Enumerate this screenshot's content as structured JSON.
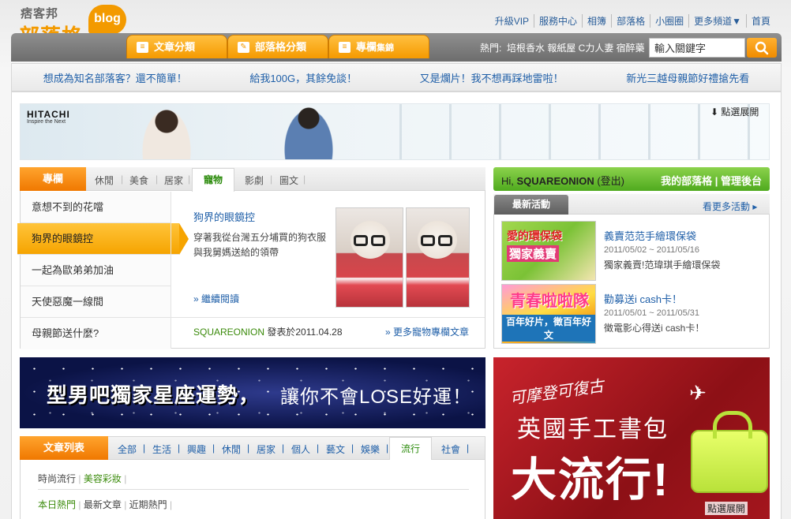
{
  "header": {
    "logo_small": "痞客邦",
    "logo_big": "部落格",
    "logo_badge": "blog",
    "top_links": [
      "升級VIP",
      "服務中心",
      "相簿",
      "部落格",
      "小圈圈",
      "更多頻道▼",
      "首頁"
    ],
    "nav_tabs": [
      "文章分類",
      "部落格分類",
      "專欄"
    ],
    "nav_tab_suffix": "集錦",
    "hot_label": "熱門:",
    "hot_words": "培根香水 報紙屋 C力人妻 宿醉藥",
    "search": {
      "placeholder": "輸入關鍵字",
      "value": "輸入關鍵字"
    }
  },
  "promo_links": [
    "想成為知名部落客？還不簡單！",
    "給我100G，其餘免談！",
    "又是爛片！我不想再踩地雷啦！",
    "新光三越母親節好禮搶先看"
  ],
  "banner": {
    "brand": "HITACHI",
    "brand_sub": "Inspire the Next",
    "expand_label": "點選展開"
  },
  "column": {
    "head_label": "專欄",
    "tabs": [
      "休閒",
      "美食",
      "居家",
      "寵物",
      "影劇",
      "圖文"
    ],
    "active_tab": "寵物",
    "list": [
      "意想不到的花噹",
      "狗界的眼鏡控",
      "一起為歐弟弟加油",
      "天使惡魔一線間",
      "母親節送什麼?"
    ],
    "active_item": "狗界的眼鏡控",
    "article_title": "狗界的眼鏡控",
    "article_body": "穿著我從台灣五分埔買的狗衣服與我舅媽送給的領帶",
    "read_more": "» 繼續閱讀",
    "author": "SQUAREONION",
    "posted": " 發表於2011.04.28",
    "more_link": "» 更多寵物專欄文章"
  },
  "user": {
    "greeting": "Hi, ",
    "name": "SQUAREONION",
    "logout": " (登出)",
    "my_blog": "我的部落格",
    "admin": "管理後台"
  },
  "events": {
    "tab_label": "最新活動",
    "more": "看更多活動 ▸",
    "items": [
      {
        "title": "義賣范范手繪環保袋",
        "date": "2011/05/02 ~ 2011/05/16",
        "desc": "獨家義賣!范瑋琪手繪環保袋",
        "img_line1": "愛的環保袋",
        "img_line2": "獨家義賣"
      },
      {
        "title": "勸募送i cash卡！",
        "date": "2011/05/01 ~ 2011/05/31",
        "desc": "徵電影心得送i cash卡！",
        "img_line1": "青春啦啦隊",
        "img_line2": "百年好片，徵百年好文"
      }
    ]
  },
  "horoscope": {
    "text_bold": "型男吧獨家星座運勢，",
    "text_light": "讓你不會LOSE好運！"
  },
  "article_list": {
    "head_label": "文章列表",
    "tabs": [
      "全部",
      "生活",
      "興趣",
      "休閒",
      "居家",
      "個人",
      "藝文",
      "娛樂",
      "流行",
      "社會"
    ],
    "active_tab": "流行",
    "sub_tabs": [
      "時尚流行",
      "美容彩妝"
    ],
    "sort_tabs": [
      "本日熱門",
      "最新文章",
      "近期熱門"
    ]
  },
  "ad": {
    "line1": "可摩登可復古",
    "line2": "英國手工書包",
    "line3": "大流行!",
    "expand_label": "點選展開"
  },
  "colors": {
    "orange": "#f39a00",
    "green": "#4faa1e",
    "link": "#1f5fa8"
  }
}
